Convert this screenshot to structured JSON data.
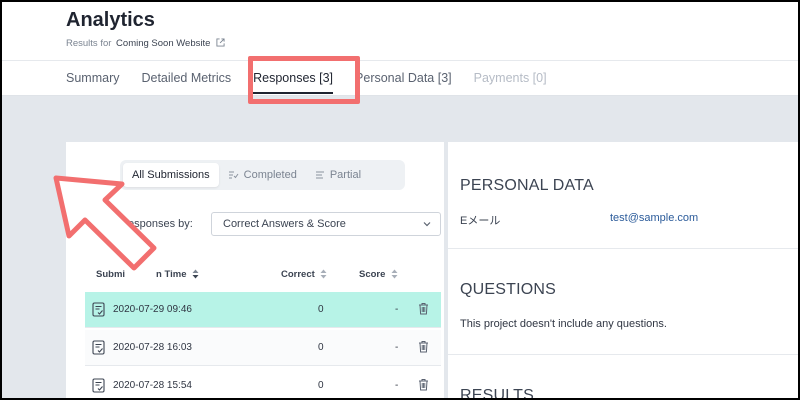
{
  "app": {
    "title": "Analytics",
    "results_for_label": "Results for",
    "site_name": "Coming Soon Website"
  },
  "tabs": [
    {
      "label": "Summary",
      "state": "normal"
    },
    {
      "label": "Detailed Metrics",
      "state": "normal"
    },
    {
      "label": "Responses [3]",
      "state": "active"
    },
    {
      "label": "Personal Data [3]",
      "state": "normal"
    },
    {
      "label": "Payments [0]",
      "state": "disabled"
    }
  ],
  "filters": {
    "segments": [
      {
        "label": "All Submissions",
        "icon": "none",
        "active": true
      },
      {
        "label": "Completed",
        "icon": "checklist-icon",
        "active": false
      },
      {
        "label": "Partial",
        "icon": "lines-icon",
        "active": false
      }
    ],
    "responses_by_label": "esponses by:",
    "select_value": "Correct Answers & Score"
  },
  "table": {
    "headers": {
      "time": "Submi",
      "time_tail": "n Time",
      "correct": "Correct",
      "score": "Score"
    },
    "rows": [
      {
        "date": "2020-07-29 09:46",
        "correct": "0",
        "score": "-",
        "selected": true
      },
      {
        "date": "2020-07-28 16:03",
        "correct": "0",
        "score": "-",
        "selected": false
      },
      {
        "date": "2020-07-28 15:54",
        "correct": "0",
        "score": "-",
        "selected": false
      }
    ]
  },
  "personal_data": {
    "title": "PERSONAL DATA",
    "key": "Eメール",
    "value": "test@sample.com"
  },
  "questions": {
    "title": "QUESTIONS",
    "text": "This project doesn't include any questions."
  },
  "results": {
    "title": "RESULTS"
  },
  "colors": {
    "highlight": "#f26f6f",
    "selected_row": "#b7f3e7",
    "link": "#2b5b9a",
    "page_bg": "#e3e7ec"
  }
}
